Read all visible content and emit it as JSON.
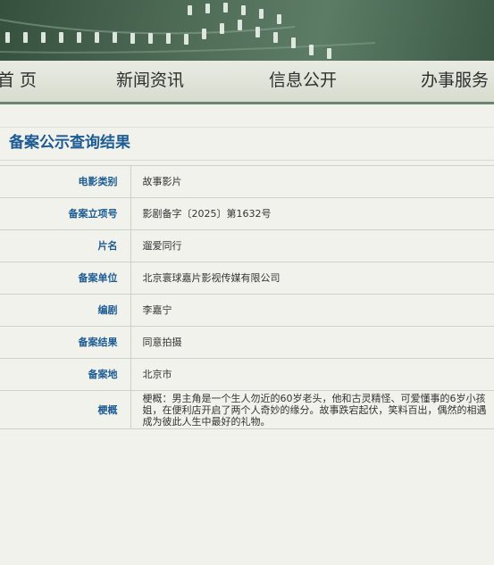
{
  "nav": {
    "items": [
      {
        "label": "首 页"
      },
      {
        "label": "新闻资讯"
      },
      {
        "label": "信息公开"
      },
      {
        "label": "办事服务"
      }
    ]
  },
  "page_title": "备案公示查询结果",
  "record": {
    "rows": [
      {
        "label": "电影类别",
        "value": "故事影片"
      },
      {
        "label": "备案立项号",
        "value": "影剧备字〔2025〕第1632号"
      },
      {
        "label": "片名",
        "value": "遛爱同行"
      },
      {
        "label": "备案单位",
        "value": "北京寰球嘉片影视传媒有限公司"
      },
      {
        "label": "编剧",
        "value": "李嘉宁"
      },
      {
        "label": "备案结果",
        "value": "同意拍摄"
      },
      {
        "label": "备案地",
        "value": "北京市"
      },
      {
        "label": "梗概",
        "value": "梗概：男主角是一个生人勿近的60岁老头，他和古灵精怪、可爱懂事的6岁小孩姐，在便利店开启了两个人奇妙的缘分。故事跌宕起伏，笑料百出，偶然的相遇成为彼此人生中最好的礼物。"
      }
    ]
  },
  "colors": {
    "banner": "#4d6a55",
    "nav_border": "#6d8474",
    "accent_blue": "#1d5b93",
    "background": "#f1f2eb"
  }
}
